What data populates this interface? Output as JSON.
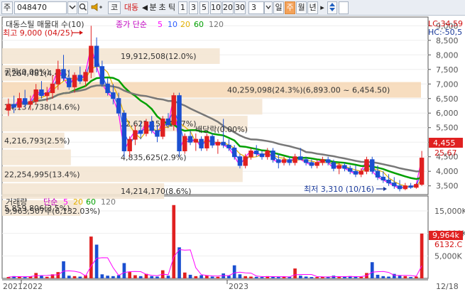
{
  "toolbar": {
    "market_label": "주",
    "stock_code": "048470",
    "speaker_icon": "speaker-icon",
    "mode_label": "코",
    "stock_name": "대동",
    "prev_arrow": "◀",
    "minute_label": "분",
    "tick_label": "초",
    "tick2_label": "틱",
    "intervals": [
      "1",
      "3",
      "5",
      "10",
      "20",
      "30"
    ],
    "interval_value": "3",
    "period_day": "일",
    "period_week": "주",
    "period_month": "월",
    "period_year": "년",
    "next_arrow": "▸",
    "updown_icon": "up-down-arrows-icon"
  },
  "price_panel": {
    "title": "대동스틸 매물대 수(10)",
    "ma_legend_prefix": "종가 단순",
    "ma_periods": [
      "5",
      "10",
      "20",
      "60",
      "120"
    ],
    "ma_colors": [
      "#ff00ff",
      "#3060ff",
      "#e3b000",
      "#00a000",
      "#777777"
    ],
    "high_note": "최고 9,000 (04/25)",
    "low_note": "최저 3,310 (10/16)",
    "hint_text": "공락(0.00%)",
    "ex_rights_text": "배당락(0.00%)",
    "lc_label": "LC:34,59",
    "hc_label": "HC:-50,5",
    "current_price": "4,455",
    "current_change": "25.67",
    "volume_profile": [
      {
        "label": "19,912,508(12.0%)"
      },
      {
        "label": "7,264,481(4.4%)"
      },
      {
        "label": "40,259,098(24.3%)(6,893.00 ~ 6,454.50)"
      },
      {
        "label": "24,137,738(14.6%)"
      },
      {
        "label": "22,622,158(13.7%)"
      },
      {
        "label": "4,216,793(2.5%)"
      },
      {
        "label": "4,835,625(2.9%)"
      },
      {
        "label": "22,254,995(13.4%)"
      },
      {
        "label": "14,214,170(8.6%)"
      },
      {
        "label": "5,859,806(3.5%)"
      }
    ],
    "y_ticks": [
      "9,000",
      "8,500",
      "8,000",
      "7,500",
      "7,000",
      "6,500",
      "6,000",
      "5,500",
      "5,000",
      "4,500",
      "4,000",
      "3,500"
    ]
  },
  "volume_panel": {
    "title": "거래량",
    "ma_legend_prefix": "단순",
    "ma_periods": [
      "5",
      "20",
      "60",
      "120"
    ],
    "ma_colors": [
      "#ff00ff",
      "#e3b000",
      "#00a000",
      "#777777"
    ],
    "peak_note": "9,963,507주(6,132.03%)",
    "current_volume": "9,964k",
    "current_ma": "6132.C",
    "y_ticks": [
      "15,000K",
      "10,000K",
      "5,000K"
    ]
  },
  "x_axis": {
    "labels": [
      "2021",
      "2022",
      "2023",
      "12/18"
    ]
  },
  "chart_data": {
    "type": "candlestick",
    "title": "대동스틸 매물대 수(10)",
    "y_range": [
      3200,
      9300
    ],
    "volume_y_range": [
      0,
      18000
    ],
    "x_labels": [
      "2021",
      "2022",
      "2023",
      "12/18"
    ],
    "price_series": [
      {
        "name": "5",
        "color": "#ff00ff"
      },
      {
        "name": "10",
        "color": "#3060ff"
      },
      {
        "name": "20",
        "color": "#e3b000"
      },
      {
        "name": "60",
        "color": "#00a000"
      },
      {
        "name": "120",
        "color": "#777777"
      }
    ],
    "candles": [
      {
        "o": 6100,
        "h": 6500,
        "l": 5900,
        "c": 6300
      },
      {
        "o": 6300,
        "h": 6600,
        "l": 6000,
        "c": 6200
      },
      {
        "o": 6200,
        "h": 6700,
        "l": 6100,
        "c": 6500
      },
      {
        "o": 6500,
        "h": 6800,
        "l": 6200,
        "c": 6300
      },
      {
        "o": 6300,
        "h": 6600,
        "l": 6100,
        "c": 6400
      },
      {
        "o": 6400,
        "h": 7000,
        "l": 6300,
        "c": 6800
      },
      {
        "o": 6800,
        "h": 7100,
        "l": 6500,
        "c": 6600
      },
      {
        "o": 6600,
        "h": 6900,
        "l": 6400,
        "c": 6700
      },
      {
        "o": 6700,
        "h": 7300,
        "l": 6500,
        "c": 7000
      },
      {
        "o": 7000,
        "h": 7800,
        "l": 6800,
        "c": 7500
      },
      {
        "o": 7500,
        "h": 8000,
        "l": 7100,
        "c": 7200
      },
      {
        "o": 7200,
        "h": 7500,
        "l": 6800,
        "c": 6900
      },
      {
        "o": 6900,
        "h": 7400,
        "l": 6700,
        "c": 7300
      },
      {
        "o": 7300,
        "h": 7600,
        "l": 7000,
        "c": 7100
      },
      {
        "o": 7100,
        "h": 7500,
        "l": 6900,
        "c": 7400
      },
      {
        "o": 7400,
        "h": 9000,
        "l": 7200,
        "c": 8300
      },
      {
        "o": 8300,
        "h": 8600,
        "l": 7400,
        "c": 7600
      },
      {
        "o": 7600,
        "h": 7800,
        "l": 6900,
        "c": 7000
      },
      {
        "o": 7000,
        "h": 7200,
        "l": 6600,
        "c": 6700
      },
      {
        "o": 6700,
        "h": 7000,
        "l": 6300,
        "c": 6500
      },
      {
        "o": 6500,
        "h": 6700,
        "l": 5900,
        "c": 6000
      },
      {
        "o": 6000,
        "h": 6100,
        "l": 4500,
        "c": 4700
      },
      {
        "o": 4700,
        "h": 5200,
        "l": 4500,
        "c": 5100
      },
      {
        "o": 5100,
        "h": 5600,
        "l": 4900,
        "c": 5400
      },
      {
        "o": 5400,
        "h": 5700,
        "l": 5100,
        "c": 5300
      },
      {
        "o": 5300,
        "h": 5800,
        "l": 5200,
        "c": 5700
      },
      {
        "o": 5700,
        "h": 5900,
        "l": 5300,
        "c": 5400
      },
      {
        "o": 5400,
        "h": 5600,
        "l": 5000,
        "c": 5200
      },
      {
        "o": 5200,
        "h": 5900,
        "l": 5100,
        "c": 5800
      },
      {
        "o": 5800,
        "h": 6000,
        "l": 5500,
        "c": 5600
      },
      {
        "o": 5600,
        "h": 6700,
        "l": 5400,
        "c": 6600
      },
      {
        "o": 6600,
        "h": 6700,
        "l": 4500,
        "c": 4700
      },
      {
        "o": 4700,
        "h": 5300,
        "l": 4600,
        "c": 5200
      },
      {
        "o": 5200,
        "h": 5400,
        "l": 4900,
        "c": 5000
      },
      {
        "o": 5000,
        "h": 5300,
        "l": 4700,
        "c": 5100
      },
      {
        "o": 5100,
        "h": 5200,
        "l": 4700,
        "c": 4800
      },
      {
        "o": 4800,
        "h": 5300,
        "l": 4700,
        "c": 5200
      },
      {
        "o": 5200,
        "h": 5300,
        "l": 4800,
        "c": 4900
      },
      {
        "o": 4900,
        "h": 5100,
        "l": 4600,
        "c": 5000
      },
      {
        "o": 5000,
        "h": 5800,
        "l": 4800,
        "c": 4900
      },
      {
        "o": 4900,
        "h": 5100,
        "l": 4700,
        "c": 4800
      },
      {
        "o": 4800,
        "h": 4900,
        "l": 4400,
        "c": 4500
      },
      {
        "o": 4500,
        "h": 4600,
        "l": 4100,
        "c": 4200
      },
      {
        "o": 4200,
        "h": 4600,
        "l": 4100,
        "c": 4500
      },
      {
        "o": 4500,
        "h": 4800,
        "l": 4400,
        "c": 4700
      },
      {
        "o": 4700,
        "h": 4900,
        "l": 4500,
        "c": 4600
      },
      {
        "o": 4600,
        "h": 4700,
        "l": 4400,
        "c": 4500
      },
      {
        "o": 4500,
        "h": 4800,
        "l": 4400,
        "c": 4700
      },
      {
        "o": 4700,
        "h": 4800,
        "l": 4300,
        "c": 4400
      },
      {
        "o": 4400,
        "h": 4600,
        "l": 4100,
        "c": 4300
      },
      {
        "o": 4300,
        "h": 4500,
        "l": 4200,
        "c": 4400
      },
      {
        "o": 4400,
        "h": 4500,
        "l": 4200,
        "c": 4300
      },
      {
        "o": 4300,
        "h": 4600,
        "l": 4200,
        "c": 4500
      },
      {
        "o": 4500,
        "h": 4800,
        "l": 4400,
        "c": 4400
      },
      {
        "o": 4400,
        "h": 4500,
        "l": 4200,
        "c": 4300
      },
      {
        "o": 4300,
        "h": 4400,
        "l": 4100,
        "c": 4200
      },
      {
        "o": 4200,
        "h": 4400,
        "l": 4100,
        "c": 4300
      },
      {
        "o": 4300,
        "h": 4500,
        "l": 4200,
        "c": 4400
      },
      {
        "o": 4400,
        "h": 4500,
        "l": 4200,
        "c": 4300
      },
      {
        "o": 4300,
        "h": 4400,
        "l": 4000,
        "c": 4100
      },
      {
        "o": 4100,
        "h": 4300,
        "l": 3900,
        "c": 4200
      },
      {
        "o": 4200,
        "h": 4300,
        "l": 4000,
        "c": 4100
      },
      {
        "o": 4100,
        "h": 4200,
        "l": 3900,
        "c": 4000
      },
      {
        "o": 4000,
        "h": 4200,
        "l": 3800,
        "c": 3900
      },
      {
        "o": 3900,
        "h": 4100,
        "l": 3800,
        "c": 4000
      },
      {
        "o": 4000,
        "h": 4500,
        "l": 3900,
        "c": 4400
      },
      {
        "o": 4400,
        "h": 4500,
        "l": 3900,
        "c": 4000
      },
      {
        "o": 4000,
        "h": 4200,
        "l": 3700,
        "c": 3800
      },
      {
        "o": 3800,
        "h": 4000,
        "l": 3600,
        "c": 3700
      },
      {
        "o": 3700,
        "h": 3900,
        "l": 3500,
        "c": 3600
      },
      {
        "o": 3600,
        "h": 3800,
        "l": 3400,
        "c": 3500
      },
      {
        "o": 3500,
        "h": 3700,
        "l": 3310,
        "c": 3400
      },
      {
        "o": 3400,
        "h": 3600,
        "l": 3350,
        "c": 3500
      },
      {
        "o": 3500,
        "h": 3600,
        "l": 3400,
        "c": 3450
      },
      {
        "o": 3450,
        "h": 3600,
        "l": 3400,
        "c": 3550
      },
      {
        "o": 3550,
        "h": 4700,
        "l": 3500,
        "c": 4455
      }
    ],
    "volumes": [
      300,
      500,
      400,
      300,
      450,
      1200,
      600,
      350,
      900,
      1400,
      3800,
      600,
      500,
      400,
      700,
      9300,
      7500,
      900,
      600,
      500,
      700,
      3400,
      1400,
      700,
      500,
      1000,
      500,
      400,
      1800,
      600,
      16300,
      6900,
      1300,
      800,
      500,
      700,
      600,
      400,
      350,
      1100,
      600,
      2900,
      900,
      500,
      400,
      350,
      300,
      500,
      400,
      300,
      350,
      300,
      2200,
      600,
      400,
      300,
      300,
      400,
      300,
      600,
      300,
      350,
      500,
      400,
      350,
      1200,
      3600,
      800,
      500,
      400,
      1000,
      700,
      500,
      300,
      400,
      9964
    ]
  }
}
